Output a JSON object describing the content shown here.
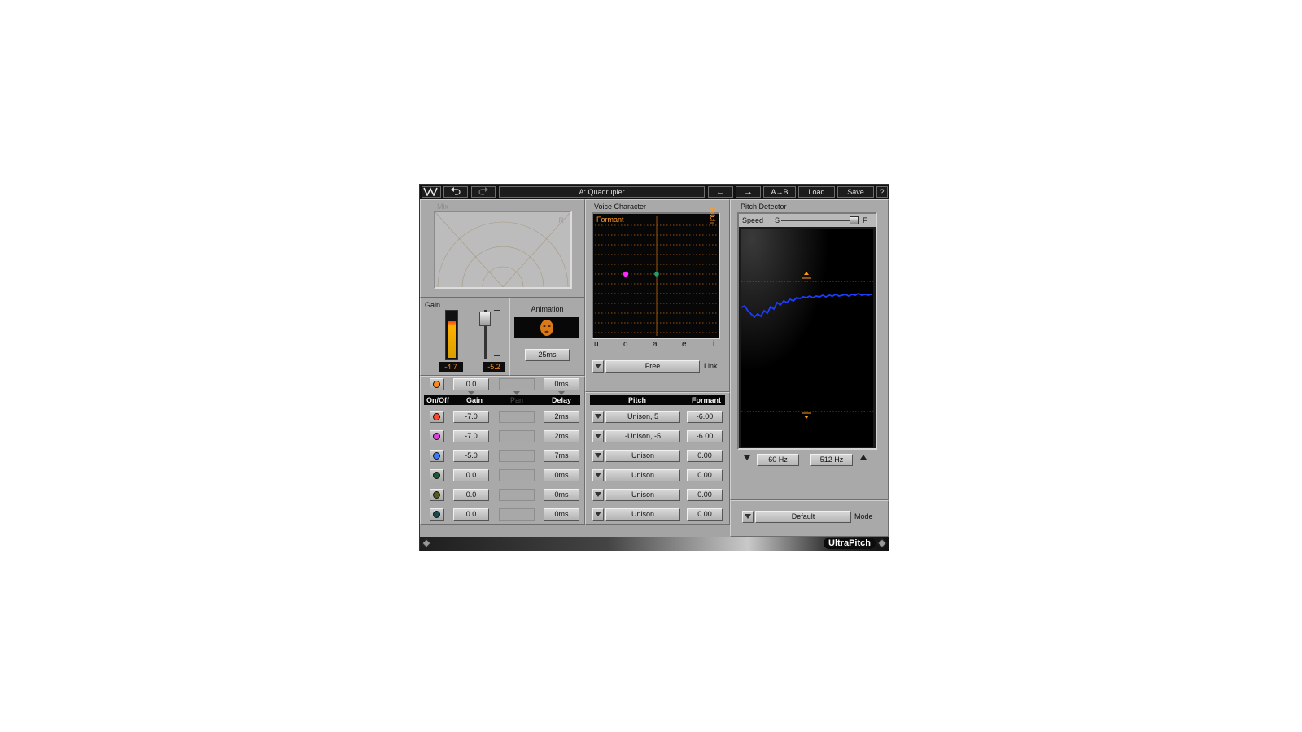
{
  "toolbar": {
    "undo_icon": "undo-icon",
    "redo_icon": "redo-icon",
    "preset_name": "A: Quadrupler",
    "prev_label": "←",
    "next_label": "→",
    "ab_label": "A→B",
    "load_label": "Load",
    "save_label": "Save",
    "help_label": "?"
  },
  "mix": {
    "title": "Mix",
    "r_label": "R"
  },
  "gain": {
    "title": "Gain",
    "meter_value": "-4.7",
    "fader_value": "-5.2",
    "meter_level": 0.8
  },
  "animation": {
    "title": "Animation",
    "time": "25ms"
  },
  "voice": {
    "title": "Voice Character",
    "formant_label": "Formant",
    "pitch_label": "Pitch",
    "vowels": [
      "u",
      "o",
      "a",
      "e",
      "i"
    ],
    "link_mode": "Free",
    "link_label": "Link"
  },
  "master_row": {
    "gain": "0.0",
    "delay": "0ms"
  },
  "columns": {
    "onoff": "On/Off",
    "gain": "Gain",
    "pan": "Pan",
    "delay": "Delay",
    "pitch": "Pitch",
    "formant": "Formant"
  },
  "voices": [
    {
      "color": "#ff4a2a",
      "gain": "-7.0",
      "delay": "2ms",
      "pitch": "Unison, 5",
      "formant": "-6.00"
    },
    {
      "color": "#e040e0",
      "gain": "-7.0",
      "delay": "2ms",
      "pitch": "-Unison, -5",
      "formant": "-6.00"
    },
    {
      "color": "#3a7aff",
      "gain": "-5.0",
      "delay": "7ms",
      "pitch": "Unison",
      "formant": "0.00"
    },
    {
      "color": "#1b5a33",
      "gain": "0.0",
      "delay": "0ms",
      "pitch": "Unison",
      "formant": "0.00"
    },
    {
      "color": "#5a5a1b",
      "gain": "0.0",
      "delay": "0ms",
      "pitch": "Unison",
      "formant": "0.00"
    },
    {
      "color": "#1b4a4a",
      "gain": "0.0",
      "delay": "0ms",
      "pitch": "Unison",
      "formant": "0.00"
    }
  ],
  "detector": {
    "title": "Pitch Detector",
    "speed_label": "Speed",
    "slow_label": "S",
    "fast_label": "F",
    "low_freq": "60 Hz",
    "high_freq": "512 Hz",
    "mode_value": "Default",
    "mode_label": "Mode"
  },
  "brand": "UltraPitch",
  "colors": {
    "accent": "#ff8a1a",
    "pitch_curve": "#1d3cff",
    "background": "#a4a4a4"
  }
}
